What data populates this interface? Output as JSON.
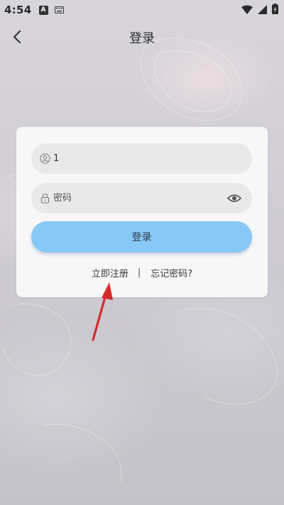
{
  "status_bar": {
    "time": "4:54",
    "notification_letter": "A"
  },
  "header": {
    "title": "登录"
  },
  "login_form": {
    "username_value": "1",
    "password_placeholder": "密码",
    "login_label": "登录",
    "register_label": "立即注册",
    "separator": "|",
    "forgot_label": "忘记密码?"
  },
  "colors": {
    "login_button": "#87c8f6",
    "annotation_arrow": "#d42a2a"
  },
  "icons": {
    "back": "chevron-left-icon",
    "username": "user-icon",
    "password": "lock-icon",
    "visibility": "eye-icon",
    "annotation": "arrow-icon"
  }
}
